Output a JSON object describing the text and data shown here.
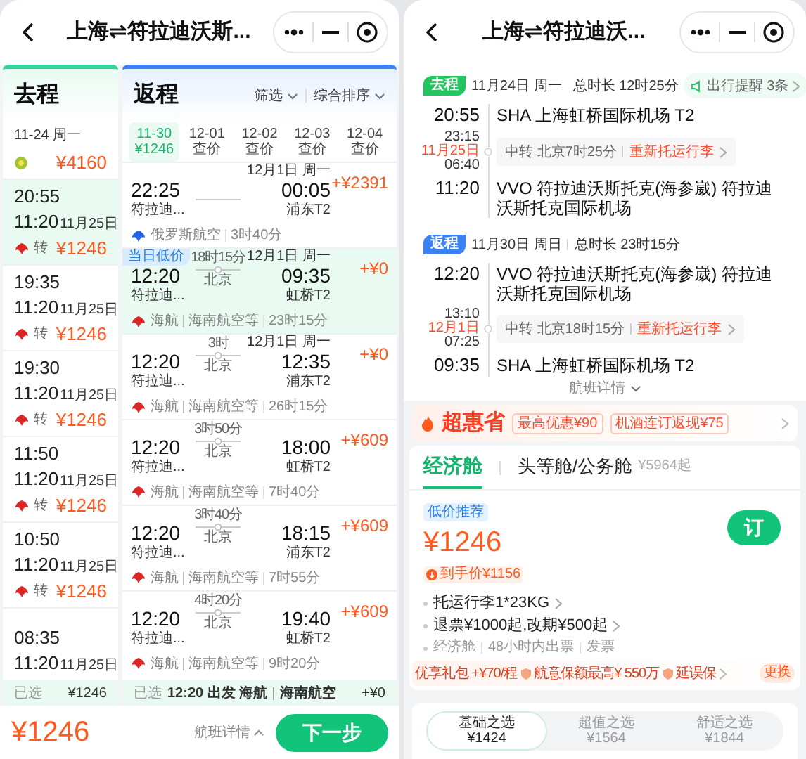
{
  "left_screen": {
    "title": "上海⇌符拉迪沃斯...",
    "outbound_column": {
      "heading": "去程",
      "date": "11-24 周一",
      "lowest_price": "¥4160",
      "flights": [
        {
          "depart": "20:55",
          "arrive": "11:20",
          "arrive_date": "11月25日",
          "transfer": "转",
          "price": "¥1246",
          "selected": true
        },
        {
          "depart": "19:35",
          "arrive": "11:20",
          "arrive_date": "11月25日",
          "transfer": "转",
          "price": "¥1246",
          "selected": false
        },
        {
          "depart": "19:30",
          "arrive": "11:20",
          "arrive_date": "11月25日",
          "transfer": "转",
          "price": "¥1246",
          "selected": false
        },
        {
          "depart": "11:50",
          "arrive": "11:20",
          "arrive_date": "11月25日",
          "transfer": "转",
          "price": "¥1246",
          "selected": false
        },
        {
          "depart": "10:50",
          "arrive": "11:20",
          "arrive_date": "11月25日",
          "transfer": "转",
          "price": "¥1246",
          "selected": false
        },
        {
          "depart": "08:35",
          "arrive": "11:20",
          "arrive_date": "11月25日",
          "selected": false
        }
      ]
    },
    "return_column": {
      "heading": "返程",
      "filter": "筛选",
      "sort": "综合排序",
      "dates": [
        {
          "date": "11-30",
          "price": "¥1246",
          "selected": true
        },
        {
          "date": "12-01",
          "price": "查价",
          "selected": false
        },
        {
          "date": "12-02",
          "price": "查价",
          "selected": false
        },
        {
          "date": "12-03",
          "price": "查价",
          "selected": false
        },
        {
          "date": "12-04",
          "price": "查价",
          "selected": false
        }
      ],
      "flights": [
        {
          "depart": "22:25",
          "from": "符拉迪...",
          "arrive_date": "12月1日 周一",
          "arrive": "00:05",
          "to": "浦东T2",
          "price": "+¥2391",
          "airline": "俄罗斯航空",
          "duration": "3时40分",
          "color": "#2563eb",
          "selected": false
        },
        {
          "badge": "当日低价",
          "depart": "12:20",
          "from": "符拉迪...",
          "stop_time": "18时15分",
          "stop": "北京",
          "arrive_date": "12月1日 周一",
          "arrive": "09:35",
          "to": "虹桥T2",
          "price": "+¥0",
          "airline": "海航",
          "operator": "海南航空等",
          "duration": "23时15分",
          "color": "#dc2626",
          "selected": true
        },
        {
          "depart": "12:20",
          "from": "符拉迪...",
          "stop_time": "3时",
          "stop": "北京",
          "arrive_date": "12月1日 周一",
          "arrive": "12:35",
          "to": "浦东T2",
          "price": "+¥0",
          "airline": "海航",
          "operator": "海南航空等",
          "duration": "26时15分",
          "color": "#dc2626",
          "selected": false
        },
        {
          "depart": "12:20",
          "from": "符拉迪...",
          "stop_time": "3时50分",
          "stop": "北京",
          "arrive": "18:00",
          "to": "虹桥T2",
          "price": "+¥609",
          "airline": "海航",
          "operator": "海南航空等",
          "duration": "7时40分",
          "color": "#dc2626",
          "selected": false
        },
        {
          "depart": "12:20",
          "from": "符拉迪...",
          "stop_time": "3时40分",
          "stop": "北京",
          "arrive": "18:15",
          "to": "浦东T2",
          "price": "+¥609",
          "airline": "海航",
          "operator": "海南航空等",
          "duration": "7时55分",
          "color": "#dc2626",
          "selected": false
        },
        {
          "depart": "12:20",
          "from": "符拉迪...",
          "stop_time": "4时20分",
          "stop": "北京",
          "arrive": "19:40",
          "to": "虹桥T2",
          "price": "+¥609",
          "airline": "海航",
          "operator": "海南航空等",
          "duration": "9时20分",
          "color": "#dc2626",
          "selected": false
        }
      ]
    },
    "selected_bar": {
      "outbound_label": "已选",
      "outbound_price": "¥1246",
      "return_label": "已选",
      "return_summary": "12:20 出发 海航",
      "return_operator": "海南航空",
      "return_price": "+¥0"
    },
    "footer": {
      "total": "¥1246",
      "details": "航班详情",
      "next": "下一步"
    }
  },
  "right_screen": {
    "title": "上海⇌符拉迪沃...",
    "legs": [
      {
        "tag": "去程",
        "color": "#22c55e",
        "date": "11月24日 周一",
        "duration": "总时长 12时25分",
        "reminder": "出行提醒 3条",
        "depart_time": "20:55",
        "depart_airport": "SHA 上海虹桥国际机场 T2",
        "transfer": {
          "arrive": "23:15",
          "date": "11月25日",
          "depart": "06:40",
          "text": "中转 北京7时25分",
          "notice": "重新托运行李"
        },
        "arrive_time": "11:20",
        "arrive_airport": "VVO 符拉迪沃斯托克(海参崴) 符拉迪沃斯托克国际机场"
      },
      {
        "tag": "返程",
        "color": "#3b82f6",
        "date": "11月30日 周日",
        "duration": "总时长 23时15分",
        "depart_time": "12:20",
        "depart_airport": "VVO 符拉迪沃斯托克(海参崴) 符拉迪沃斯托克国际机场",
        "transfer": {
          "arrive": "13:10",
          "date": "12月1日",
          "depart": "07:25",
          "text": "中转 北京18时15分",
          "notice": "重新托运行李"
        },
        "arrive_time": "09:35",
        "arrive_airport": "SHA 上海虹桥国际机场 T2"
      }
    ],
    "details_link": "航班详情",
    "promo": {
      "brand": "超惠省",
      "offers": [
        "最高优惠¥90",
        "机酒连订返现¥75"
      ]
    },
    "cabins": [
      {
        "name": "经济舱",
        "selected": true
      },
      {
        "name": "头等舱/公务舱",
        "price": "¥5964起",
        "selected": false
      }
    ],
    "offer": {
      "badge": "低价推荐",
      "price": "¥1246",
      "net_price": "到手价¥1156",
      "book": "订",
      "features": [
        "托运行李1*23KG",
        "退票¥1000起,改期¥500起"
      ],
      "notes": [
        "经济舱",
        "48小时内出票",
        "发票"
      ]
    },
    "package": {
      "title": "优享礼包 +¥70/程",
      "items": [
        "航意保额最高¥ 550万",
        "延误保"
      ],
      "change": "更换"
    },
    "bundles": [
      {
        "name": "基础之选",
        "price": "¥1424",
        "selected": true
      },
      {
        "name": "超值之选",
        "price": "¥1564",
        "selected": false
      },
      {
        "name": "舒适之选",
        "price": "¥1844",
        "selected": false
      }
    ]
  }
}
